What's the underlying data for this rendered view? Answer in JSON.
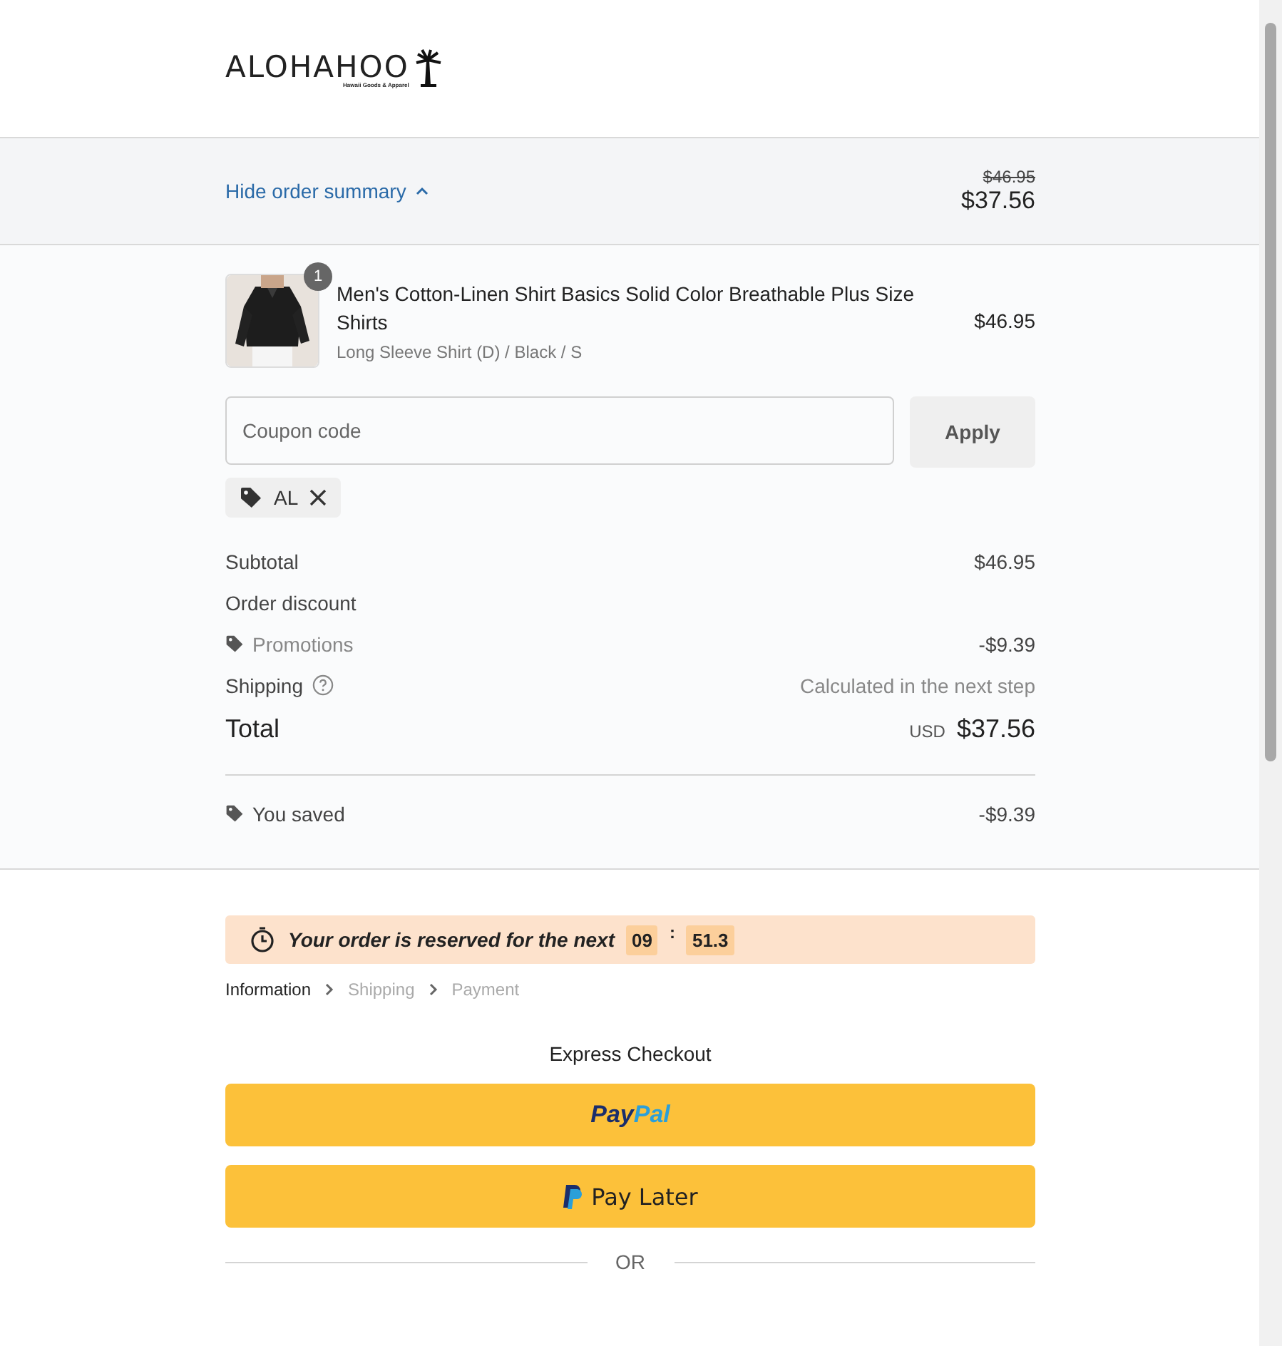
{
  "logo": {
    "name": "ALOHAHOO",
    "tagline": "Hawaii Goods & Apparel"
  },
  "summary_toggle": {
    "label": "Hide order summary",
    "expanded": true,
    "original_price": "$46.95",
    "price": "$37.56"
  },
  "line_items": [
    {
      "quantity": "1",
      "title": "Men's Cotton-Linen Shirt Basics Solid Color Breathable Plus Size Shirts",
      "variant": "Long Sleeve Shirt (D) / Black / S",
      "price": "$46.95"
    }
  ],
  "coupon": {
    "placeholder": "Coupon code",
    "button": "Apply",
    "applied": [
      "AL"
    ]
  },
  "summary_rows": [
    {
      "kind": "plain",
      "label": "Subtotal",
      "value": "$46.95"
    },
    {
      "kind": "plain",
      "label": "Order discount"
    },
    {
      "kind": "promo",
      "label": "Promotions",
      "value": "-$9.39"
    },
    {
      "kind": "shipping",
      "label": "Shipping",
      "value": "Calculated in the next step"
    },
    {
      "kind": "total",
      "label": "Total",
      "currency": "USD",
      "value": "$37.56"
    }
  ],
  "savings": {
    "label": "You saved",
    "value": "-$9.39"
  },
  "reservation": {
    "text": "Your order is reserved for the next",
    "minutes": "09",
    "separator": ":",
    "seconds": "51.3"
  },
  "breadcrumbs": [
    {
      "label": "Information",
      "selected": true
    },
    {
      "label": "Shipping",
      "selected": false
    },
    {
      "label": "Payment",
      "selected": false
    }
  ],
  "express_checkout": {
    "title": "Express Checkout",
    "buttons": [
      {
        "kind": "paypal",
        "label": "Pay",
        "label_2": "Pal"
      },
      {
        "kind": "paylater",
        "label": "Pay Later"
      }
    ],
    "divider": "OR"
  }
}
